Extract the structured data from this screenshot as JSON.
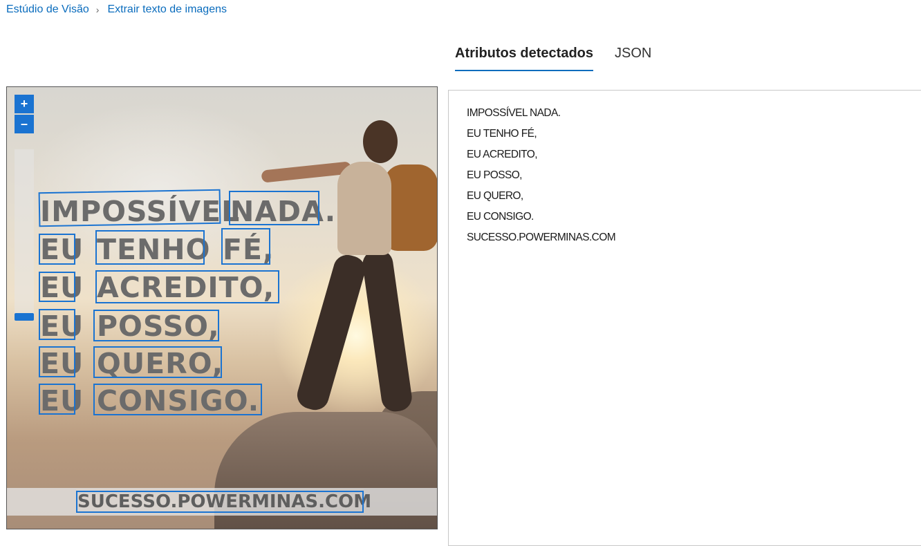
{
  "breadcrumb": {
    "root": "Estúdio de Visão",
    "separator": "›",
    "current": "Extrair texto de imagens"
  },
  "tabs": {
    "attributes": "Atributos detectados",
    "json": "JSON"
  },
  "zoom": {
    "in_label": "+",
    "out_label": "–"
  },
  "image_text": {
    "w1": "IMPOSSÍVEL",
    "w2": "NADA.",
    "w3": "EU",
    "w4": "TENHO",
    "w5": "FÉ,",
    "w6": "EU",
    "w7": "ACREDITO,",
    "w8": "EU",
    "w9": "POSSO,",
    "w10": "EU",
    "w11": "QUERO,",
    "w12": "EU",
    "w13": "CONSIGO.",
    "w14": "SUCESSO.POWERMINAS.COM"
  },
  "results": {
    "lines": [
      "IMPOSSÍVEL NADA.",
      "EU TENHO FÉ,",
      "EU ACREDITO,",
      "EU POSSO,",
      "EU QUERO,",
      "EU CONSIGO.",
      "SUCESSO.POWERMINAS.COM"
    ]
  },
  "colors": {
    "accent": "#1a73d1",
    "link": "#0a6cbd"
  }
}
